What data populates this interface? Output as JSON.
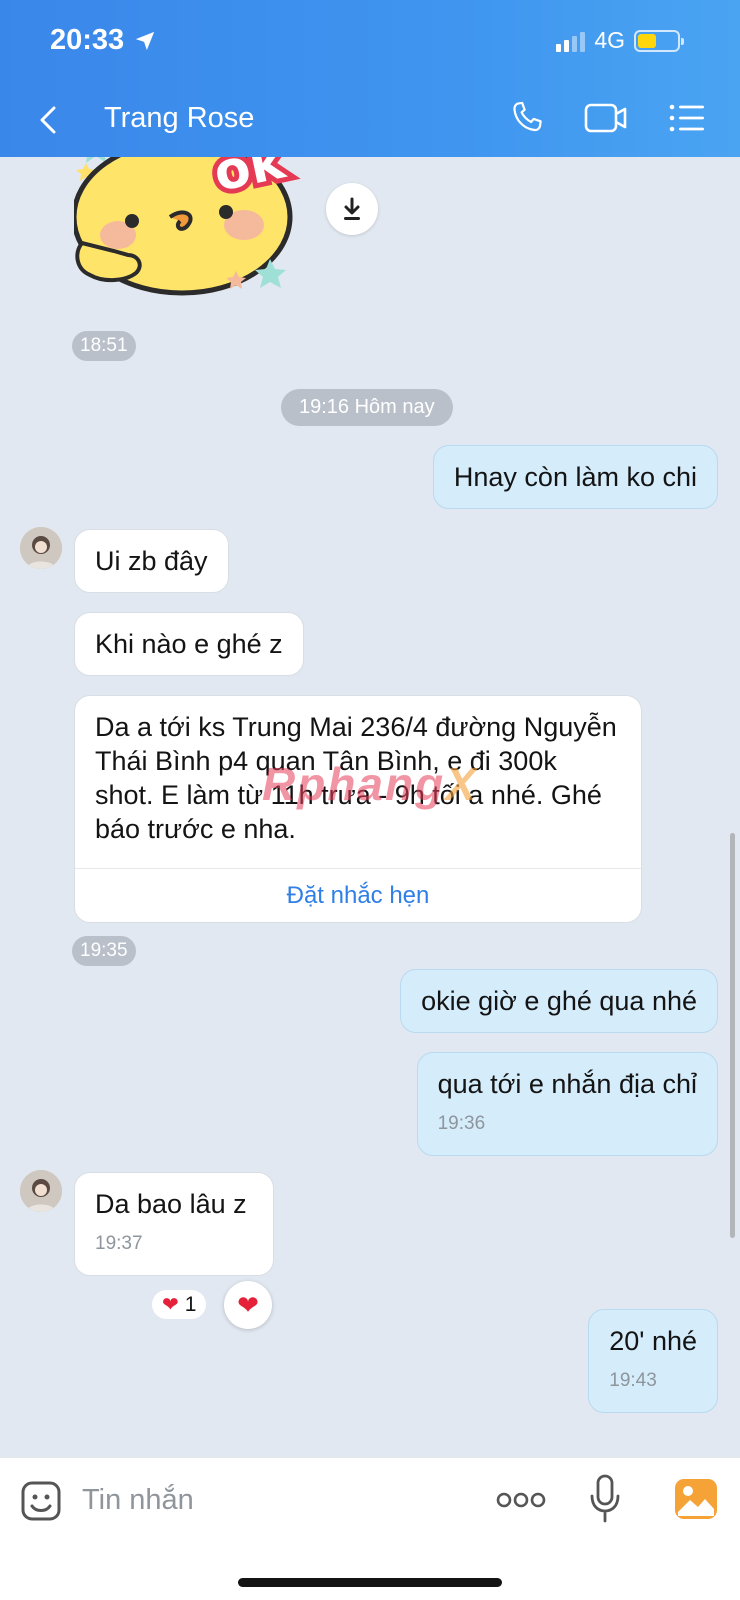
{
  "status": {
    "time": "20:33",
    "network": "4G"
  },
  "header": {
    "contact_name": "Trang Rose"
  },
  "messages": {
    "sticker_time": "18:51",
    "date_separator": "19:16 Hôm nay",
    "m1": {
      "text": "Hnay còn làm ko chi"
    },
    "m2": {
      "text": "Ui zb đây"
    },
    "m3": {
      "text": "Khi nào e ghé z"
    },
    "m4": {
      "text": "Da a tới ks Trung Mai 236/4  đường Nguyễn Thái Bình p4 quan Tân Bình, e đi 300k shot. E làm từ 11h trưa - 9h tối a nhé. Ghé báo trước e nha.",
      "action": "Đặt nhắc hẹn"
    },
    "m4_time": "19:35",
    "m5": {
      "text": "okie giờ e ghé qua nhé"
    },
    "m6": {
      "text": "qua tới e nhắn địa chỉ",
      "time": "19:36"
    },
    "m7": {
      "text": "Da bao lâu z",
      "time": "19:37",
      "reaction_count": "1"
    },
    "m8": {
      "text": "20' nhé",
      "time": "19:43"
    }
  },
  "sticker": {
    "label": "ok"
  },
  "watermark": {
    "text": "Rphang",
    "suffix": "X"
  },
  "composer": {
    "placeholder": "Tin nhắn"
  },
  "colors": {
    "header": "#3a87ea",
    "link": "#2f7fe6",
    "outgoing_bubble": "#d5ecfb",
    "chat_bg": "#e2e8f1"
  }
}
